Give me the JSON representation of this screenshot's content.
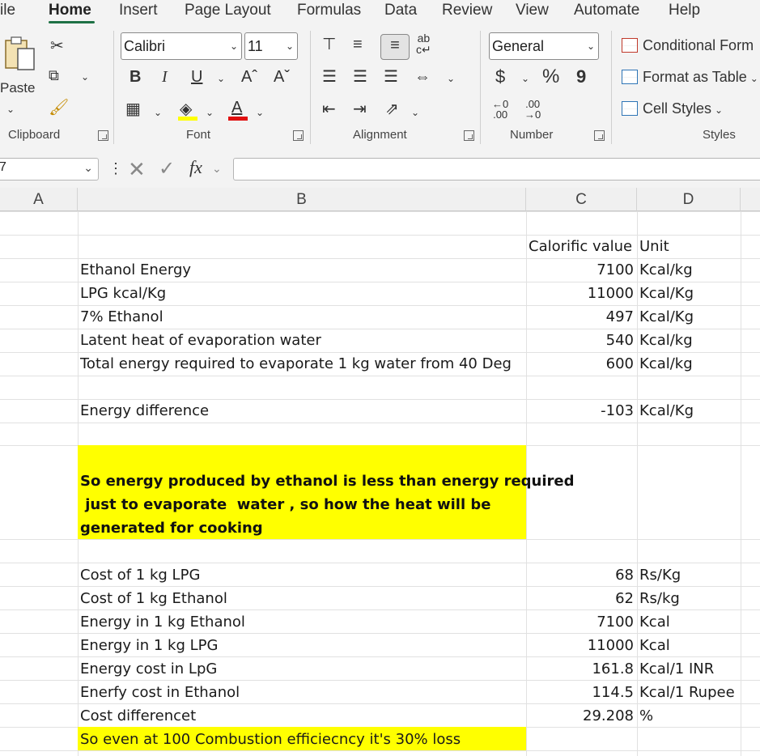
{
  "tabs": [
    "ile",
    "Home",
    "Insert",
    "Page Layout",
    "Formulas",
    "Data",
    "Review",
    "View",
    "Automate",
    "Help"
  ],
  "ribbon": {
    "clipboard": {
      "paste_label": "Paste",
      "group_label": "Clipboard"
    },
    "font": {
      "font_name": "Calibri",
      "font_size": "11",
      "group_label": "Font",
      "bold": "B",
      "italic": "I",
      "underline": "U",
      "grow": "Aˆ",
      "shrink": "Aˇ",
      "font_color": "A"
    },
    "alignment": {
      "group_label": "Alignment"
    },
    "number": {
      "format": "General",
      "currency": "$",
      "percent": "%",
      "comma": "9",
      "group_label": "Number"
    },
    "styles": {
      "conditional": "Conditional Form",
      "format_table": "Format as Table",
      "cell_styles": "Cell Styles",
      "group_label": "Styles"
    }
  },
  "formula_bar": {
    "name_box": "7",
    "fx": "fx",
    "formula": ""
  },
  "columns": [
    "A",
    "B",
    "C",
    "D"
  ],
  "sheet": {
    "header": {
      "c": "Calorific value",
      "d": "Unit"
    },
    "rows1": [
      {
        "b": "Ethanol Energy",
        "c": "7100",
        "d": "Kcal/kg"
      },
      {
        "b": "LPG kcal/Kg",
        "c": "11000",
        "d": "Kcal/Kg"
      },
      {
        "b": "7% Ethanol",
        "c": "497",
        "d": "Kcal/Kg"
      },
      {
        "b": "Latent heat of evaporation water",
        "c": "540",
        "d": "Kcal/kg"
      },
      {
        "b": "Total energy required to evaporate 1 kg water from 40 Deg",
        "c": "600",
        "d": "Kcal/kg"
      }
    ],
    "difference": {
      "b": "Energy difference",
      "c": "-103",
      "d": "Kcal/Kg"
    },
    "note_lines": [
      "So energy produced by ethanol is less than energy required",
      " just to evaporate  water , so how the heat will be",
      "generated for cooking"
    ],
    "rows2": [
      {
        "b": "Cost of 1 kg LPG",
        "c": "68",
        "d": "Rs/Kg"
      },
      {
        "b": "Cost of 1 kg Ethanol",
        "c": "62",
        "d": "Rs/kg"
      },
      {
        "b": "Energy in 1 kg Ethanol",
        "c": "7100",
        "d": "Kcal"
      },
      {
        "b": "Energy in 1 kg LPG",
        "c": "11000",
        "d": "Kcal"
      },
      {
        "b": "Energy cost in LpG",
        "c": "161.8",
        "d": "Kcal/1 INR"
      },
      {
        "b": "Enerfy cost in Ethanol",
        "c": "114.5",
        "d": "Kcal/1 Rupee"
      },
      {
        "b": "Cost differencet",
        "c": "29.208",
        "d": "%"
      }
    ],
    "footer_note": "So even at 100 Combustion efficiecncy it's 30% loss"
  }
}
